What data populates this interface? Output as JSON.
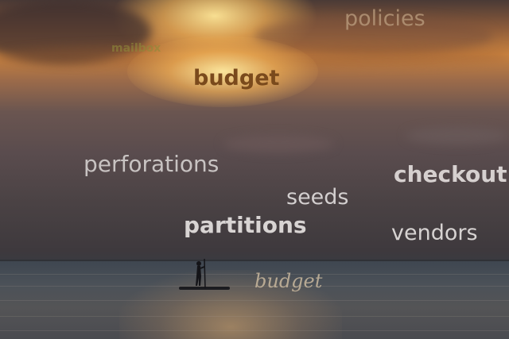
{
  "scene": {
    "description_words": {
      "budget_top": "budget",
      "policies": "policies",
      "mailbox": "mailbox",
      "perforations": "perforations",
      "checkout": "checkout",
      "seeds": "seeds",
      "partitions": "partitions",
      "vendors": "vendors",
      "budget_script": "budget"
    }
  },
  "colors": {
    "sky_top": "#4a3a36",
    "sun_glow": "#ffe6a0",
    "sea": "#4b5158"
  }
}
